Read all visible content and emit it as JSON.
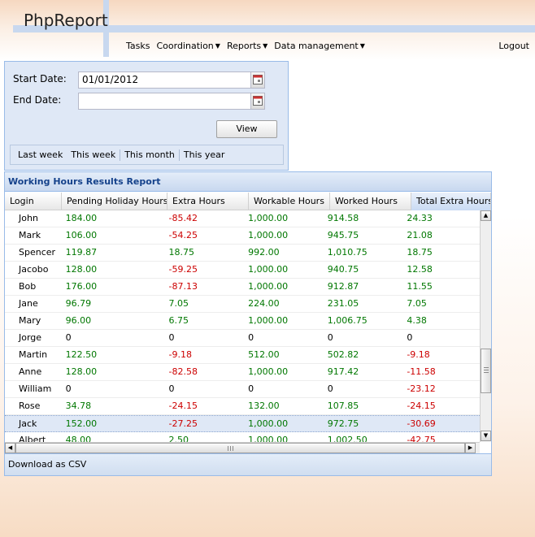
{
  "app": {
    "title": "PhpReport"
  },
  "nav": {
    "items": [
      {
        "label": "Tasks",
        "has_menu": false
      },
      {
        "label": "Coordination",
        "has_menu": true
      },
      {
        "label": "Reports",
        "has_menu": true
      },
      {
        "label": "Data management",
        "has_menu": true
      }
    ],
    "logout": "Logout"
  },
  "filters": {
    "start_label": "Start Date:",
    "start_value": "01/01/2012",
    "end_label": "End Date:",
    "end_value": "",
    "view_button": "View",
    "quick_ranges": [
      "Last week",
      "This week",
      "This month",
      "This year"
    ]
  },
  "report": {
    "title": "Working Hours Results Report",
    "columns": [
      "Login",
      "Pending Holiday Hours",
      "Extra Hours",
      "Workable Hours",
      "Worked Hours",
      "Total Extra Hours"
    ],
    "sorted_column": "Total Extra Hours",
    "selected_row": "Jack",
    "rows": [
      [
        "John",
        "184.00",
        "-85.42",
        "1,000.00",
        "914.58",
        "24.33"
      ],
      [
        "Mark",
        "106.00",
        "-54.25",
        "1,000.00",
        "945.75",
        "21.08"
      ],
      [
        "Spencer",
        "119.87",
        "18.75",
        "992.00",
        "1,010.75",
        "18.75"
      ],
      [
        "Jacobo",
        "128.00",
        "-59.25",
        "1,000.00",
        "940.75",
        "12.58"
      ],
      [
        "Bob",
        "176.00",
        "-87.13",
        "1,000.00",
        "912.87",
        "11.55"
      ],
      [
        "Jane",
        "96.79",
        "7.05",
        "224.00",
        "231.05",
        "7.05"
      ],
      [
        "Mary",
        "96.00",
        "6.75",
        "1,000.00",
        "1,006.75",
        "4.38"
      ],
      [
        "Jorge",
        "0",
        "0",
        "0",
        "0",
        "0"
      ],
      [
        "Martin",
        "122.50",
        "-9.18",
        "512.00",
        "502.82",
        "-9.18"
      ],
      [
        "Anne",
        "128.00",
        "-82.58",
        "1,000.00",
        "917.42",
        "-11.58"
      ],
      [
        "William",
        "0",
        "0",
        "0",
        "0",
        "-23.12"
      ],
      [
        "Rose",
        "34.78",
        "-24.15",
        "132.00",
        "107.85",
        "-24.15"
      ],
      [
        "Jack",
        "152.00",
        "-27.25",
        "1,000.00",
        "972.75",
        "-30.69"
      ],
      [
        "Albert",
        "48.00",
        "2.50",
        "1,000.00",
        "1,002.50",
        "-42.75"
      ]
    ],
    "download_label": "Download as CSV"
  },
  "colors": {
    "positive": "#007700",
    "negative": "#cc0000",
    "panel_title": "#15428b",
    "panel_border": "#99bbe8"
  }
}
